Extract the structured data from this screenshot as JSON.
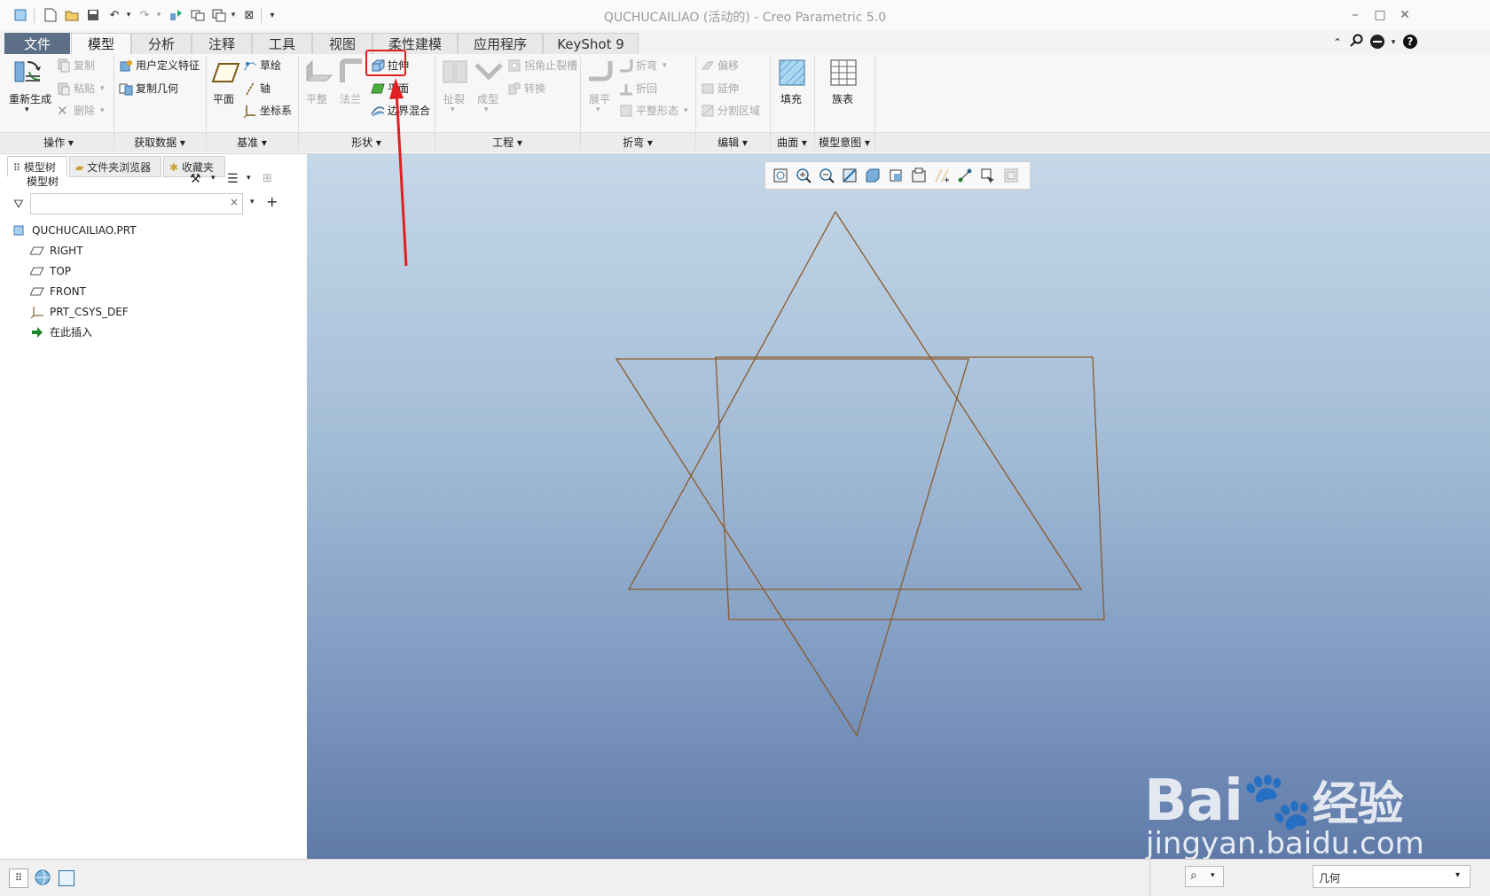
{
  "window": {
    "title": "QUCHUCAILIAO (活动的) - Creo Parametric 5.0"
  },
  "tabs": [
    {
      "label": "文件"
    },
    {
      "label": "模型"
    },
    {
      "label": "分析"
    },
    {
      "label": "注释"
    },
    {
      "label": "工具"
    },
    {
      "label": "视图"
    },
    {
      "label": "柔性建模"
    },
    {
      "label": "应用程序"
    },
    {
      "label": "KeyShot 9"
    }
  ],
  "ribbon": {
    "operations": {
      "regenerate": "重新生成",
      "copy": "复制",
      "paste": "粘贴",
      "delete": "删除",
      "group": "操作"
    },
    "get_data": {
      "udf": "用户定义特征",
      "copy_geom": "复制几何",
      "group": "获取数据"
    },
    "datum": {
      "plane": "平面",
      "sketch": "草绘",
      "axis": "轴",
      "csys": "坐标系",
      "group": "基准"
    },
    "shapes": {
      "flat": "平整",
      "flange": "法兰",
      "extrude": "拉伸",
      "planar": "平面",
      "boundary_blend": "边界混合",
      "group": "形状"
    },
    "engineering": {
      "rip": "扯裂",
      "form": "成型",
      "corner_relief": "拐角止裂槽",
      "convert": "转换",
      "group": "工程"
    },
    "bends": {
      "unbend": "展平",
      "bend": "折弯",
      "bend_back": "折回",
      "flat_pattern": "平整形态",
      "group": "折弯"
    },
    "editing": {
      "offset": "偏移",
      "extend": "延伸",
      "split_area": "分割区域",
      "group": "编辑"
    },
    "surfaces": {
      "fill": "填充",
      "group": "曲面"
    },
    "model_intent": {
      "family_table": "族表",
      "group": "模型意图"
    }
  },
  "left_panel": {
    "tabs": [
      {
        "label": "模型树"
      },
      {
        "label": "文件夹浏览器"
      },
      {
        "label": "收藏夹"
      }
    ],
    "header": "模型树",
    "search": {
      "value": "",
      "placeholder": ""
    },
    "tree": [
      {
        "label": "QUCHUCAILIAO.PRT",
        "icon": "part-icon"
      },
      {
        "label": "RIGHT",
        "icon": "datum-plane-icon"
      },
      {
        "label": "TOP",
        "icon": "datum-plane-icon"
      },
      {
        "label": "FRONT",
        "icon": "datum-plane-icon"
      },
      {
        "label": "PRT_CSYS_DEF",
        "icon": "csys-icon"
      },
      {
        "label": "在此插入",
        "icon": "insert-arrow-icon"
      }
    ]
  },
  "status": {
    "filter_value": "几何"
  },
  "watermark": {
    "brand": "Bai",
    "brand_suffix": "经验",
    "url": "jingyan.baidu.com"
  },
  "colors": {
    "sketch_line": "#8a5a2b",
    "highlight": "#e02020",
    "file_tab": "#5d6f86"
  }
}
